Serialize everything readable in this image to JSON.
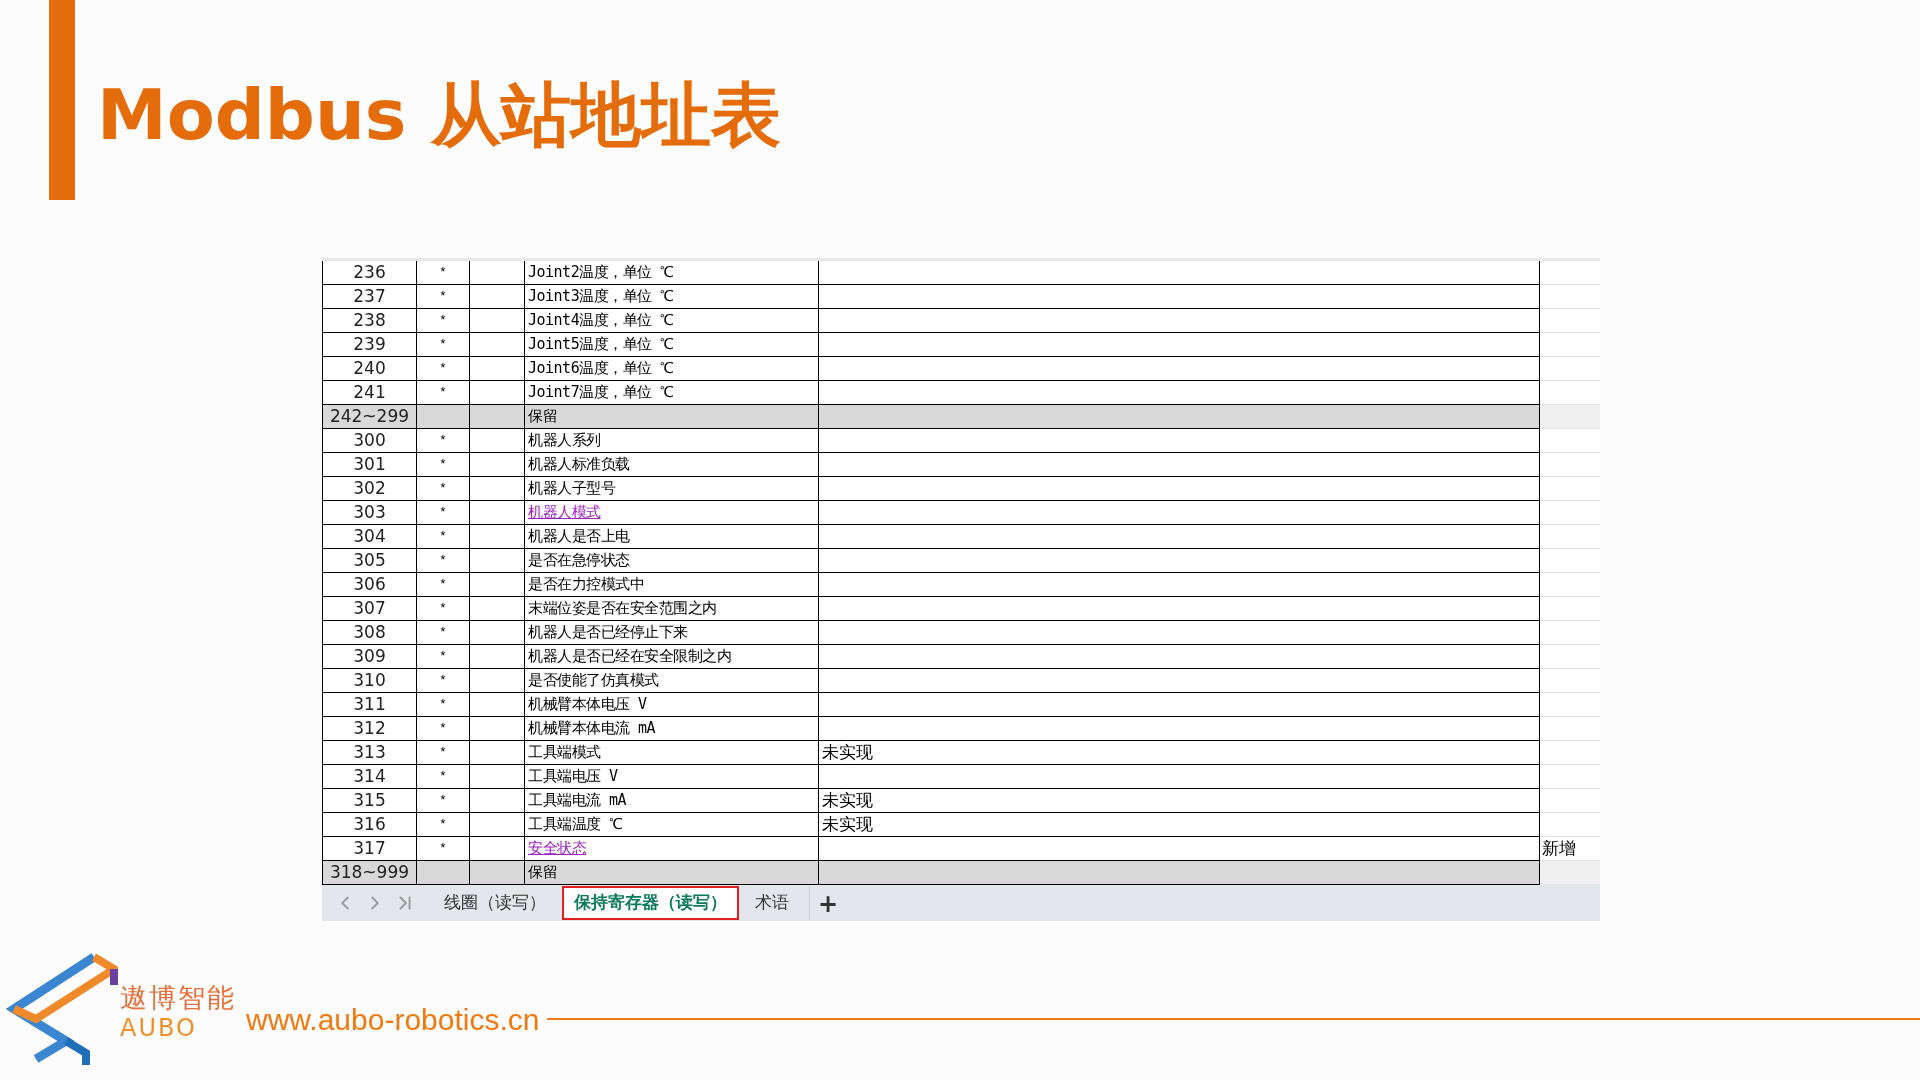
{
  "title": "Modbus 从站地址表",
  "sheet": {
    "rows": [
      {
        "kind": "register",
        "address": "236",
        "mark": "*",
        "description": "Joint2温度，单位 ℃",
        "link": false
      },
      {
        "kind": "register",
        "address": "237",
        "mark": "*",
        "description": "Joint3温度，单位 ℃",
        "link": false
      },
      {
        "kind": "register",
        "address": "238",
        "mark": "*",
        "description": "Joint4温度，单位 ℃",
        "link": false
      },
      {
        "kind": "register",
        "address": "239",
        "mark": "*",
        "description": "Joint5温度，单位 ℃",
        "link": false
      },
      {
        "kind": "register",
        "address": "240",
        "mark": "*",
        "description": "Joint6温度，单位 ℃",
        "link": false
      },
      {
        "kind": "register",
        "address": "241",
        "mark": "*",
        "description": "Joint7温度，单位 ℃",
        "link": false
      },
      {
        "kind": "reserved",
        "address": "242~299",
        "description": "保留",
        "link": false
      },
      {
        "kind": "register",
        "address": "300",
        "mark": "*",
        "description": "机器人系列",
        "link": false
      },
      {
        "kind": "register",
        "address": "301",
        "mark": "*",
        "description": "机器人标准负载",
        "link": false
      },
      {
        "kind": "register",
        "address": "302",
        "mark": "*",
        "description": "机器人子型号",
        "link": false
      },
      {
        "kind": "register",
        "address": "303",
        "mark": "*",
        "description": "机器人模式",
        "link": true
      },
      {
        "kind": "register",
        "address": "304",
        "mark": "*",
        "description": "机器人是否上电",
        "link": false
      },
      {
        "kind": "register",
        "address": "305",
        "mark": "*",
        "description": "是否在急停状态",
        "link": false
      },
      {
        "kind": "register",
        "address": "306",
        "mark": "*",
        "description": "是否在力控模式中",
        "link": false
      },
      {
        "kind": "register",
        "address": "307",
        "mark": "*",
        "description": "末端位姿是否在安全范围之内",
        "link": false
      },
      {
        "kind": "register",
        "address": "308",
        "mark": "*",
        "description": "机器人是否已经停止下来",
        "link": false
      },
      {
        "kind": "register",
        "address": "309",
        "mark": "*",
        "description": "机器人是否已经在安全限制之内",
        "link": false
      },
      {
        "kind": "register",
        "address": "310",
        "mark": "*",
        "description": "是否使能了仿真模式",
        "link": false
      },
      {
        "kind": "register",
        "address": "311",
        "mark": "*",
        "description": "机械臂本体电压 V",
        "link": false
      },
      {
        "kind": "register",
        "address": "312",
        "mark": "*",
        "description": "机械臂本体电流 mA",
        "link": false
      },
      {
        "kind": "register",
        "address": "313",
        "mark": "*",
        "description": "工具端模式",
        "link": false,
        "note": "未实现"
      },
      {
        "kind": "register",
        "address": "314",
        "mark": "*",
        "description": "工具端电压 V",
        "link": false
      },
      {
        "kind": "register",
        "address": "315",
        "mark": "*",
        "description": "工具端电流 mA",
        "link": false,
        "note": "未实现"
      },
      {
        "kind": "register",
        "address": "316",
        "mark": "*",
        "description": "工具端温度 ℃",
        "link": false,
        "note": "未实现"
      },
      {
        "kind": "register",
        "address": "317",
        "mark": "*",
        "description": "安全状态",
        "link": true,
        "extra": "新增"
      },
      {
        "kind": "reserved",
        "address": "318~999",
        "description": "保留",
        "link": false
      }
    ],
    "tabs": [
      {
        "label": "线圈（读写）",
        "selected": false
      },
      {
        "label": "保持寄存器（读写）",
        "selected": true
      },
      {
        "label": "术语",
        "selected": false
      }
    ],
    "add_tab": "+"
  },
  "footer": {
    "brand_cn": "遨博智能",
    "brand_en": "AUBO",
    "url": "www.aubo-robotics.cn"
  }
}
